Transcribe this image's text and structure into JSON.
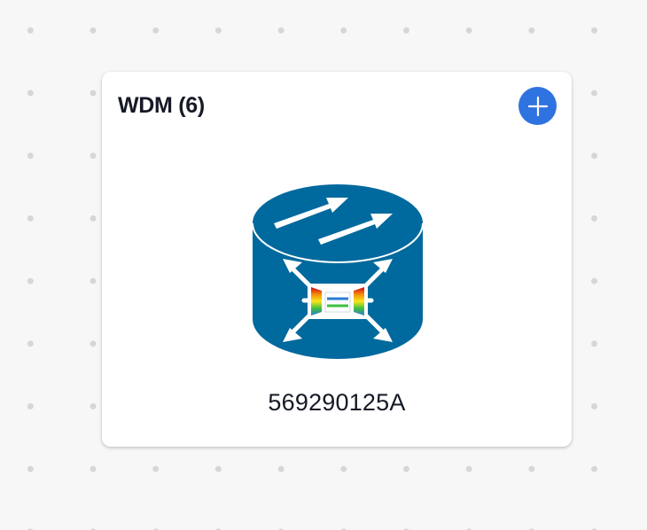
{
  "node": {
    "title": "WDM (6)",
    "add_icon": "plus-icon",
    "device_icon": "wdm-router-icon",
    "device_label": "569290125A"
  },
  "colors": {
    "background": "#f7f7f7",
    "card": "#ffffff",
    "accent": "#2f73e0",
    "device": "#00699d",
    "text": "#151a26"
  }
}
